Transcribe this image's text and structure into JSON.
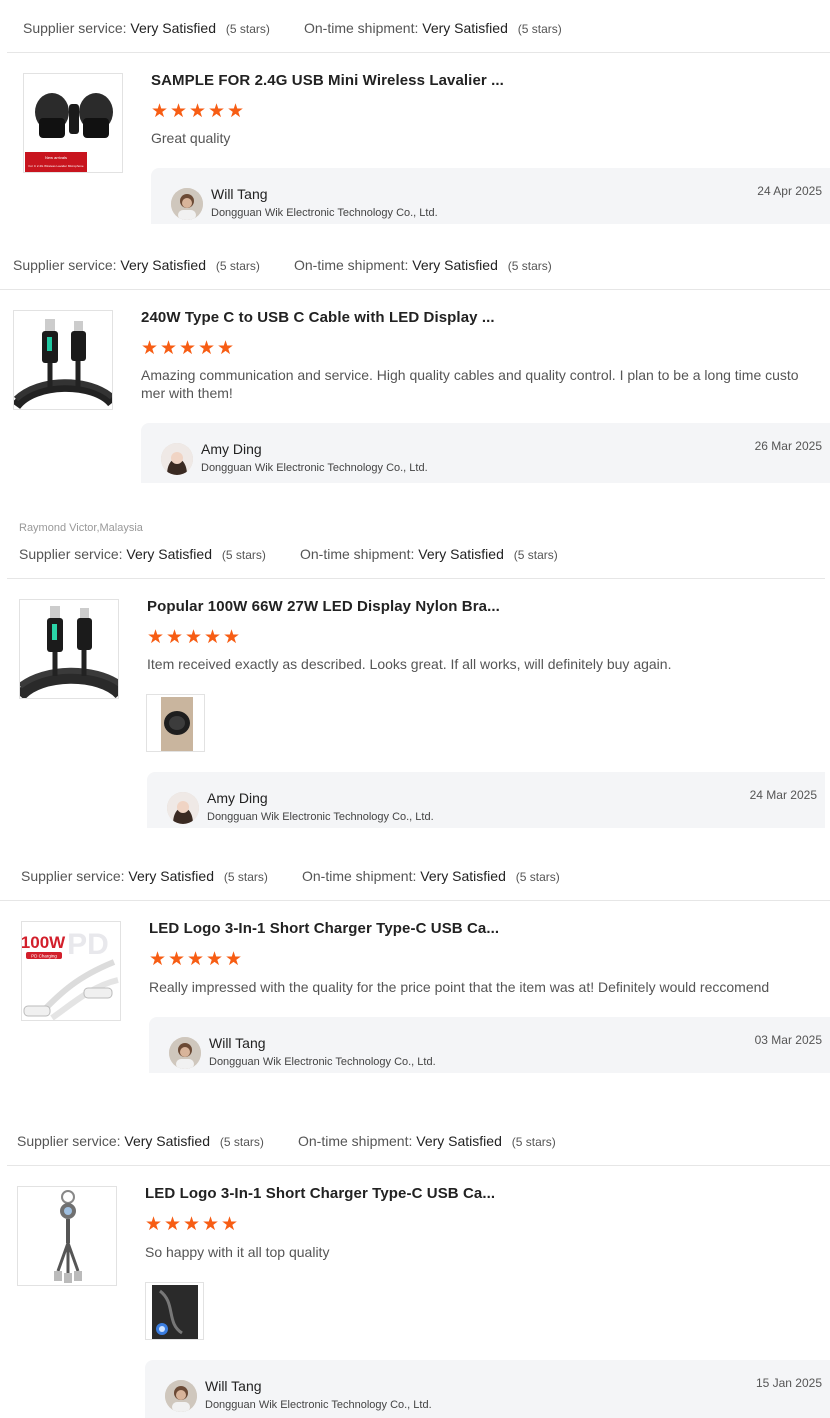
{
  "labels": {
    "supplier_service": "Supplier service:",
    "ontime_shipment": "On-time shipment:"
  },
  "reviews": [
    {
      "reviewer": "",
      "supplier_value": "Very Satisfied",
      "supplier_stars": "(5 stars)",
      "shipment_value": "Very Satisfied",
      "shipment_stars": "(5 stars)",
      "product_title": "SAMPLE FOR 2.4G USB Mini Wireless Lavalier ...",
      "rating": 5,
      "comment": "Great quality",
      "reply": {
        "name": "Will Tang",
        "company": "Dongguan Wik Electronic Technology Co., Ltd.",
        "date": "24 Apr 2025"
      }
    },
    {
      "reviewer": "",
      "supplier_value": "Very Satisfied",
      "supplier_stars": "(5 stars)",
      "shipment_value": "Very Satisfied",
      "shipment_stars": "(5 stars)",
      "product_title": "240W Type C to USB C Cable with LED Display ...",
      "rating": 5,
      "comment": "Amazing communication and service. High quality cables and quality control. I plan to be a long time custo mer with them!",
      "reply": {
        "name": "Amy Ding",
        "company": "Dongguan Wik Electronic Technology Co., Ltd.",
        "date": "26 Mar 2025"
      }
    },
    {
      "reviewer": "Raymond Victor,Malaysia",
      "supplier_value": "Very Satisfied",
      "supplier_stars": "(5 stars)",
      "shipment_value": "Very Satisfied",
      "shipment_stars": "(5 stars)",
      "product_title": "Popular 100W 66W 27W LED Display Nylon Bra...",
      "rating": 5,
      "comment": "Item received exactly as described. Looks great. If all works, will definitely buy again.",
      "reply": {
        "name": "Amy Ding",
        "company": "Dongguan Wik Electronic Technology Co., Ltd.",
        "date": "24 Mar 2025"
      }
    },
    {
      "reviewer": "",
      "supplier_value": "Very Satisfied",
      "supplier_stars": "(5 stars)",
      "shipment_value": "Very Satisfied",
      "shipment_stars": "(5 stars)",
      "product_title": "LED Logo 3-In-1 Short Charger Type-C USB Ca...",
      "rating": 5,
      "comment": "Really impressed with the quality for the price point that the item was at! Definitely would reccomend",
      "reply": {
        "name": "Will Tang",
        "company": "Dongguan Wik Electronic Technology Co., Ltd.",
        "date": "03 Mar 2025"
      }
    },
    {
      "reviewer": "",
      "supplier_value": "Very Satisfied",
      "supplier_stars": "(5 stars)",
      "shipment_value": "Very Satisfied",
      "shipment_stars": "(5 stars)",
      "product_title": "LED Logo 3-In-1 Short Charger Type-C USB Ca...",
      "rating": 5,
      "comment": "So happy with it all top quality",
      "reply": {
        "name": "Will Tang",
        "company": "Dongguan Wik Electronic Technology Co., Ltd.",
        "date": "15 Jan 2025"
      }
    }
  ],
  "image_badges": {
    "mic_badge_line1": "New arrivals",
    "mic_badge_line2": "For C 2.4G Wireless Lavalier Microphone",
    "charger_badge_big": "100W",
    "charger_badge_small": "PD Charging",
    "charger_watermark": "PD"
  },
  "colors": {
    "star": "#f75d14",
    "reply_bg": "#f4f5f7",
    "divider": "#e6e6e6"
  }
}
